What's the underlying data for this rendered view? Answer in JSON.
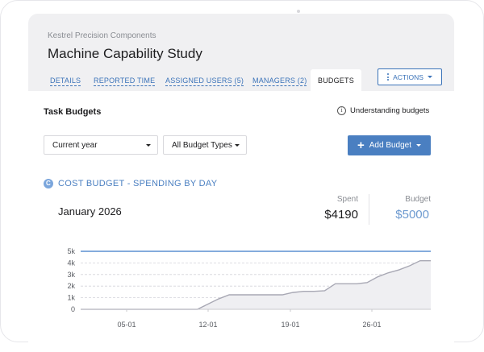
{
  "header": {
    "company": "Kestrel Precision Components",
    "title": "Machine Capability Study",
    "tabs": [
      {
        "label": "DETAILS",
        "active": false
      },
      {
        "label": "REPORTED TIME",
        "active": false
      },
      {
        "label": "ASSIGNED USERS (5)",
        "active": false
      },
      {
        "label": "MANAGERS (2)",
        "active": false
      },
      {
        "label": "BUDGETS",
        "active": true
      }
    ],
    "actions_label": "ACTIONS"
  },
  "budgets": {
    "section_title": "Task Budgets",
    "understanding_link": "Understanding budgets",
    "period_select": "Current year",
    "type_select": "All Budget Types",
    "add_button": "Add Budget"
  },
  "cost_budget": {
    "badge": "C",
    "title": "COST BUDGET - SPENDING BY DAY",
    "month": "January 2026",
    "spent_label": "Spent",
    "spent_value": "$4190",
    "budget_label": "Budget",
    "budget_value": "$5000"
  },
  "colors": {
    "accent": "#4a7fc1",
    "budget_value": "#6d9ad0",
    "budget_line": "#5b8fd0",
    "spend_line": "#a8a8b4",
    "spend_fill": "#efeff2"
  },
  "chart_data": {
    "type": "area",
    "ylim": [
      0,
      5000
    ],
    "yticks": [
      "0",
      "1k",
      "2k",
      "3k",
      "4k",
      "5k"
    ],
    "xticks": [
      "05-01",
      "12-01",
      "19-01",
      "26-01"
    ],
    "budget_line": 5000,
    "x": [
      0,
      1,
      2,
      3,
      4,
      5,
      6,
      7,
      8,
      9,
      10,
      11,
      12,
      13,
      14,
      15,
      16,
      17,
      18,
      19,
      20,
      21,
      22,
      23,
      24,
      25,
      26,
      27,
      28,
      29,
      30
    ],
    "series": [
      {
        "values": [
          0,
          0,
          0,
          0,
          0,
          0,
          0,
          0,
          0,
          0,
          0,
          0,
          450,
          900,
          1250,
          1250,
          1250,
          1250,
          1250,
          1250,
          1450,
          1550,
          1550,
          1600,
          2200,
          2200,
          2200,
          2300,
          2800,
          3150,
          3400,
          3750,
          4190,
          4190
        ]
      }
    ]
  }
}
